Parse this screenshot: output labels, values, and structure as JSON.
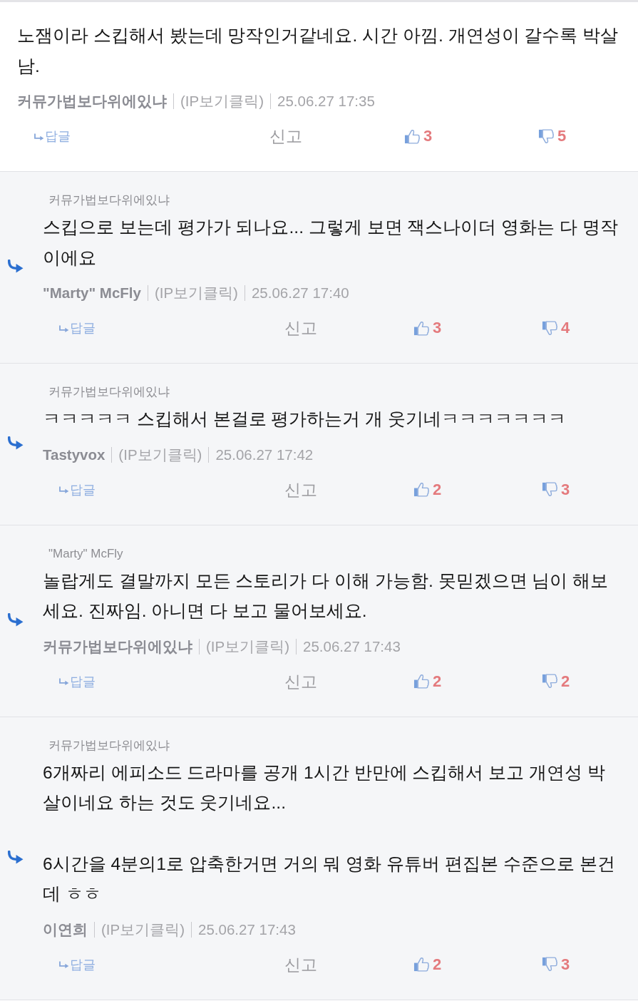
{
  "comments": [
    {
      "kind": "comment",
      "paragraphs": [
        "노잼이라 스킵해서 봤는데 망작인거같네요. 시간 아낌. 개연성이 갈수록 박살남."
      ],
      "author": "커뮤가법보다위에있냐",
      "ip_link": "(IP보기클릭)",
      "date": "25.06.27 17:35",
      "reply_label": "답글",
      "report_label": "신고",
      "likes": "3",
      "dislikes": "5"
    },
    {
      "kind": "reply",
      "parent_author": "커뮤가법보다위에있냐",
      "paragraphs": [
        "스킵으로 보는데 평가가 되나요... 그렇게 보면 잭스나이더 영화는 다 명작이에요"
      ],
      "author": "\"Marty\" McFly",
      "ip_link": "(IP보기클릭)",
      "date": "25.06.27 17:40",
      "reply_label": "답글",
      "report_label": "신고",
      "likes": "3",
      "dislikes": "4"
    },
    {
      "kind": "reply",
      "parent_author": "커뮤가법보다위에있냐",
      "paragraphs": [
        "ㅋㅋㅋㅋㅋ 스킵해서 본걸로 평가하는거 개 웃기네ㅋㅋㅋㅋㅋㅋㅋ"
      ],
      "author": "Tastyvox",
      "ip_link": "(IP보기클릭)",
      "date": "25.06.27 17:42",
      "reply_label": "답글",
      "report_label": "신고",
      "likes": "2",
      "dislikes": "3"
    },
    {
      "kind": "reply",
      "parent_author": "\"Marty\" McFly",
      "paragraphs": [
        "놀랍게도 결말까지 모든 스토리가 다 이해 가능함. 못믿겠으면 님이 해보세요. 진짜임. 아니면 다 보고 물어보세요."
      ],
      "author": "커뮤가법보다위에있냐",
      "ip_link": "(IP보기클릭)",
      "date": "25.06.27 17:43",
      "reply_label": "답글",
      "report_label": "신고",
      "likes": "2",
      "dislikes": "2"
    },
    {
      "kind": "reply",
      "parent_author": "커뮤가법보다위에있냐",
      "paragraphs": [
        "6개짜리 에피소드 드라마를 공개 1시간 반만에 스킵해서 보고 개연성 박살이네요 하는 것도 웃기네요...",
        "6시간을 4분의1로 압축한거면 거의 뭐 영화 유튜버 편집본 수준으로 본건데 ㅎㅎ"
      ],
      "author": "이연희",
      "ip_link": "(IP보기클릭)",
      "date": "25.06.27 17:43",
      "reply_label": "답글",
      "report_label": "신고",
      "likes": "2",
      "dislikes": "3"
    }
  ]
}
